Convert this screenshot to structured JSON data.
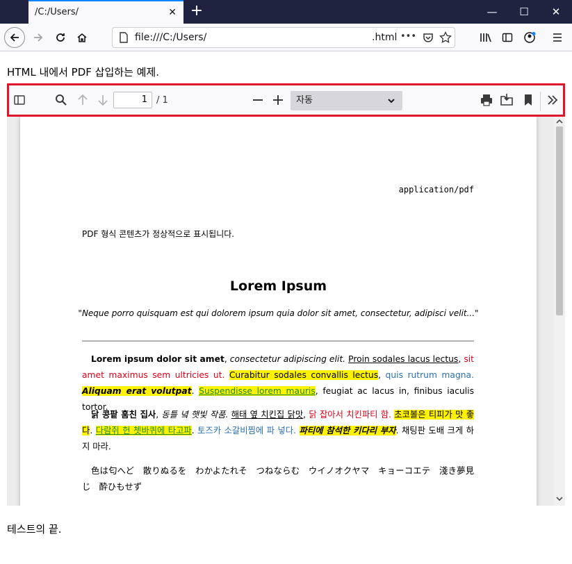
{
  "browser": {
    "tab_title": "/C:/Users/",
    "tab_close": "✕",
    "new_tab": "+",
    "window_controls": {
      "minimize": "—",
      "maximize": "☐",
      "close": "✕"
    },
    "url_left": "file:///C:/Users/",
    "url_right": ".html",
    "url_more": "•••"
  },
  "page": {
    "heading": "HTML 내에서 PDF 삽입하는 예제.",
    "footer": "테스트의 끝."
  },
  "pdf_toolbar": {
    "page_number": "1",
    "page_count": "/ 1",
    "zoom": "자동"
  },
  "document": {
    "mime": "application/pdf",
    "note": "PDF 형식 콘텐츠가 정상적으로 표시됩니다.",
    "title": "Lorem Ipsum",
    "quote": "\"Neque porro quisquam est qui dolorem ipsum quia dolor sit amet, consectetur, adipisci velit...\"",
    "p1": {
      "s1": "Lorem ipsum dolor sit amet",
      "s2": ", ",
      "s3": "consectetur adipiscing elit.",
      "s4": " ",
      "s5": "Proin sodales lacus lectus",
      "s6": ", ",
      "s7": "sit amet maximus sem ultricies ut.",
      "s8": " ",
      "s9": "Curabitur sodales convallis lectus",
      "s10": ", ",
      "s11": "quis rutrum magna.",
      "s12": " ",
      "s13": "Aliquam erat volutpat",
      "s14": ". ",
      "s15": "Suspendisse lorem mauris",
      "s16": ", feugiat ac lacus in, finibus iaculis tortor."
    },
    "p2": {
      "s1": "닭 콩팥 훔친 집사",
      "s2": ", ",
      "s3": "동틀 녘 햇빛 작품.",
      "s4": " ",
      "s5": "해태 옆 치킨집 닭맛",
      "s6": ", ",
      "s7": "닭 잡아서 치킨파티 함.",
      "s8": " ",
      "s9": "초코볼은 티피가 맛 좋다",
      "s10": ". ",
      "s11": "다람쥐 헌 쳇바퀴에 타고파",
      "s12": ". ",
      "s13": "토즈카 소갈비찜에 파 넣다.",
      "s14": " ",
      "s15": "파티에 참석한 키다리 부자",
      "s16": ". 채팅판 도배 크게 하지 마라."
    },
    "p3": "色は匂へど　散りぬるを　わかよたれそ　つねならむ　ウイノオクヤマ　キョーコエテ　淺き夢見じ　酔ひもせず"
  }
}
